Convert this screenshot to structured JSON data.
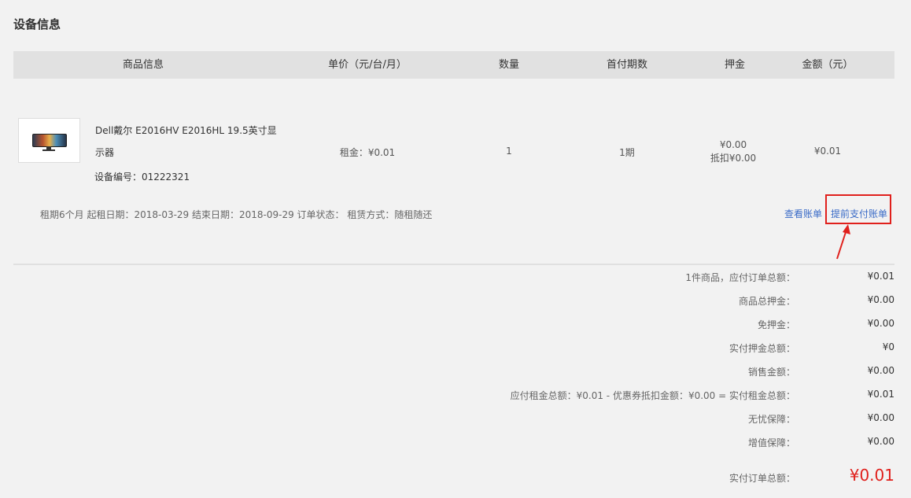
{
  "section_title": "设备信息",
  "table_headers": {
    "product": "商品信息",
    "unit_price": "单价（元/台/月）",
    "quantity": "数量",
    "first_periods": "首付期数",
    "deposit": "押金",
    "amount": "金额（元）"
  },
  "product": {
    "name": "Dell戴尔 E2016HV E2016HL 19.5英寸显示器",
    "device_no": "设备编号：01222321",
    "rent": "租金：¥0.01",
    "quantity": "1",
    "first_periods": "1期",
    "deposit": "¥0.00",
    "deposit_deduct": "抵扣¥0.00",
    "amount": "¥0.01"
  },
  "lease_info": "租期6个月 起租日期：2018-03-29 结束日期：2018-09-29 订单状态： 租赁方式：随租随还",
  "actions": {
    "view_bill": "查看账单",
    "early_pay": "提前支付账单"
  },
  "summary": [
    {
      "label": "1件商品，应付订单总额：",
      "value": "¥0.01"
    },
    {
      "label": "商品总押金：",
      "value": "¥0.00"
    },
    {
      "label": "免押金：",
      "value": "¥0.00"
    },
    {
      "label": "实付押金总额：",
      "value": "¥0"
    },
    {
      "label": "销售金额：",
      "value": "¥0.00"
    },
    {
      "label": "应付租金总额：¥0.01 - 优惠券抵扣金额：¥0.00 = 实付租金总额：",
      "value": "¥0.01"
    },
    {
      "label": "无忧保障：",
      "value": "¥0.00"
    },
    {
      "label": "增值保障：",
      "value": "¥0.00"
    }
  ],
  "total": {
    "label": "实付订单总额：",
    "value": "¥0.01"
  },
  "colors": {
    "accent_red": "#e0201c",
    "link_blue": "#3a6bc7",
    "header_bg": "#e1e1e1",
    "page_bg": "#f2f2f2"
  }
}
